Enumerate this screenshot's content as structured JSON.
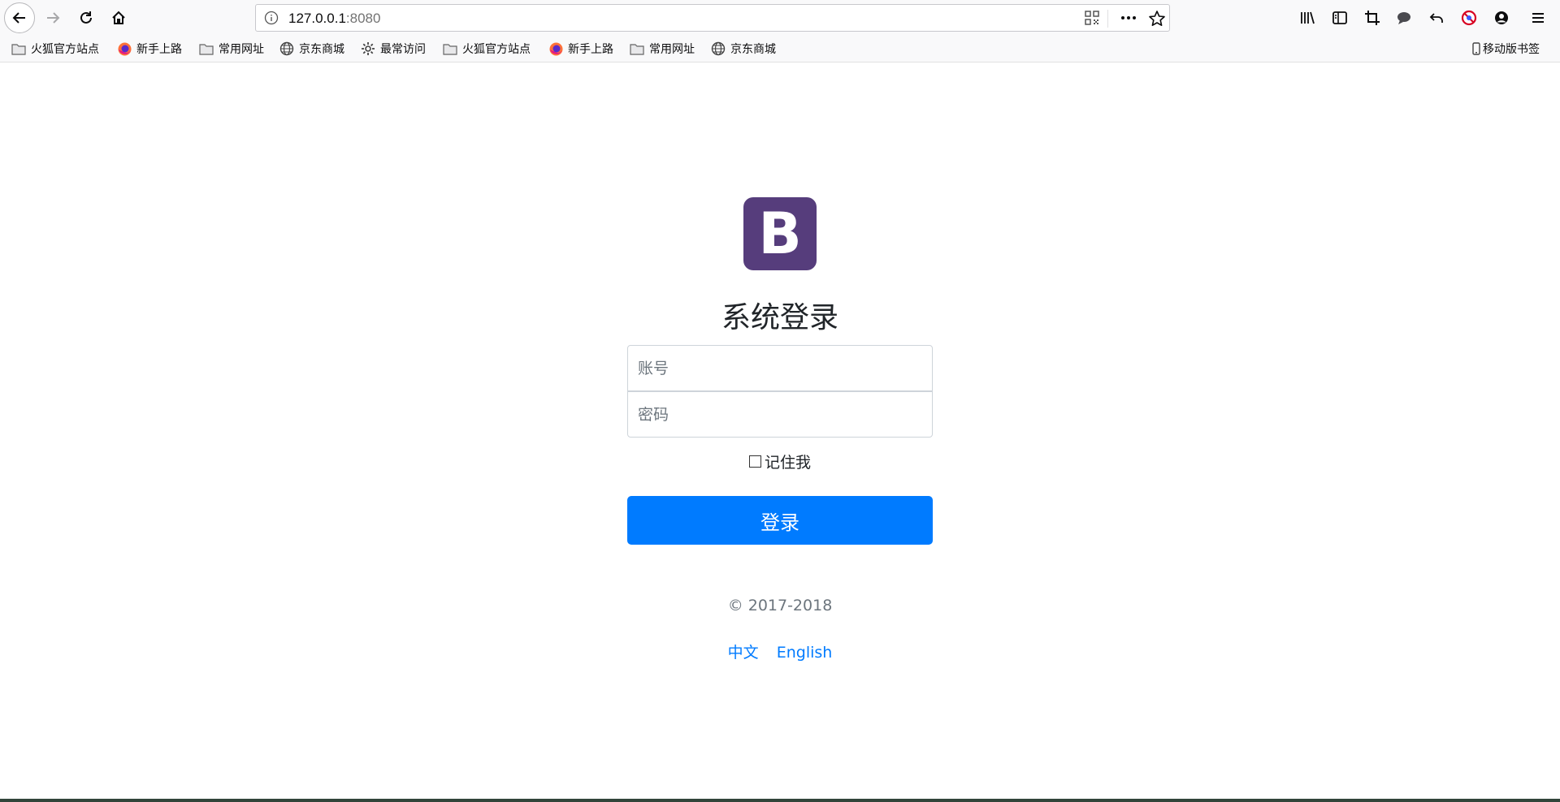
{
  "browser": {
    "url_host": "127.0.0.1",
    "url_port": ":8080",
    "bookmarks": [
      {
        "label": "火狐官方站点",
        "icon": "folder-icon"
      },
      {
        "label": "新手上路",
        "icon": "firefox-icon"
      },
      {
        "label": "常用网址",
        "icon": "folder-icon"
      },
      {
        "label": "京东商城",
        "icon": "globe-icon"
      },
      {
        "label": "最常访问",
        "icon": "gear-icon"
      },
      {
        "label": "火狐官方站点",
        "icon": "folder-icon"
      },
      {
        "label": "新手上路",
        "icon": "firefox-icon"
      },
      {
        "label": "常用网址",
        "icon": "folder-icon"
      },
      {
        "label": "京东商城",
        "icon": "globe-icon"
      }
    ],
    "mobile_bookmarks": "移动版书签"
  },
  "login": {
    "logo_letter": "B",
    "logo_color": "#563d7c",
    "title": "系统登录",
    "username_placeholder": "账号",
    "password_placeholder": "密码",
    "remember_label": "记住我",
    "remember_checked": false,
    "submit_label": "登录",
    "submit_color": "#007bff",
    "copyright": "© 2017-2018",
    "lang_zh": "中文",
    "lang_en": "English"
  }
}
